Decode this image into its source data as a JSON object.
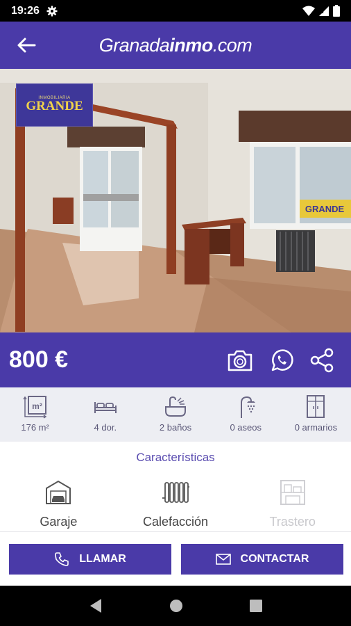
{
  "status_bar": {
    "time": "19:26"
  },
  "app_bar": {
    "title_regular": "Granada",
    "title_bold": "inmo",
    "title_suffix": ".com"
  },
  "photo": {
    "logo_small": "INMOBILIARIA",
    "logo_big": "GRANDE",
    "window_sign": "GRANDE"
  },
  "listing": {
    "price": "800 €"
  },
  "features": [
    {
      "icon": "area-icon",
      "label": "176 m²"
    },
    {
      "icon": "bed-icon",
      "label": "4 dor."
    },
    {
      "icon": "bath-icon",
      "label": "2 baños"
    },
    {
      "icon": "shower-icon",
      "label": "0 aseos"
    },
    {
      "icon": "wardrobe-icon",
      "label": "0 armarios"
    }
  ],
  "characteristics": {
    "title": "Características",
    "items": [
      {
        "icon": "garage-icon",
        "label": "Garaje",
        "active": true
      },
      {
        "icon": "radiator-icon",
        "label": "Calefacción",
        "active": true
      },
      {
        "icon": "storage-icon",
        "label": "Trastero",
        "active": false
      }
    ]
  },
  "buttons": {
    "call": "LLAMAR",
    "contact": "CONTACTAR"
  },
  "colors": {
    "brand": "#4a3aa8",
    "feature_bg": "#edeef3",
    "section_title": "#5a4cb0"
  }
}
